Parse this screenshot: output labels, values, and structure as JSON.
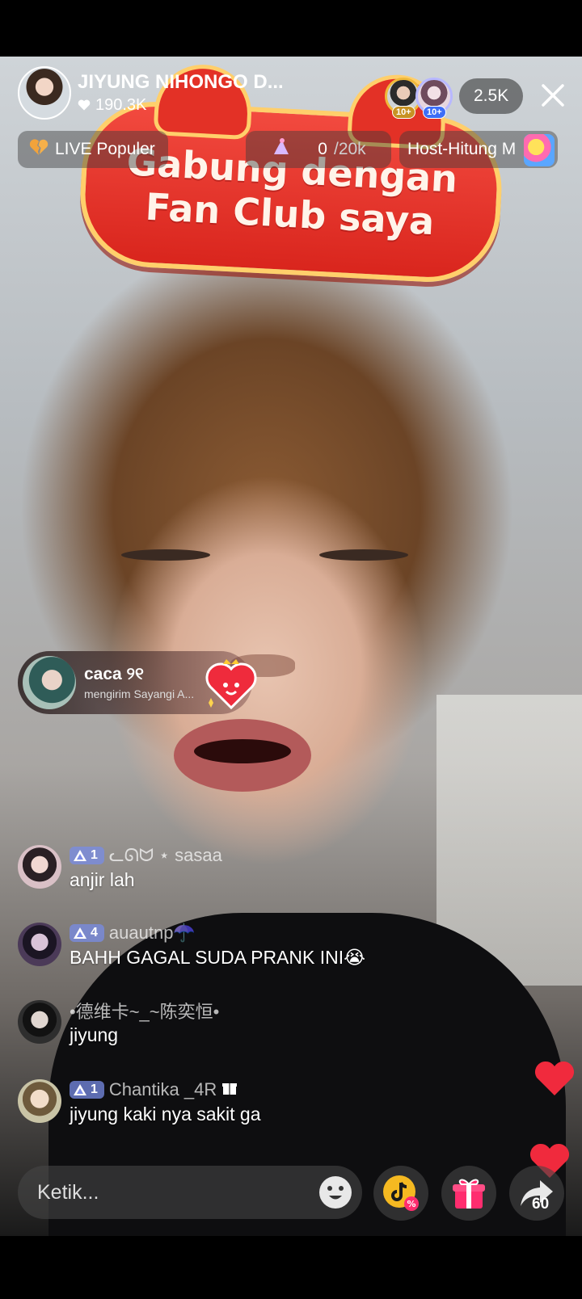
{
  "host": {
    "name": "JIYUNG NIHONGO D...",
    "likes": "190.3K"
  },
  "viewers": {
    "badge_1": "10+",
    "badge_2": "10+",
    "count": "2.5K"
  },
  "chips": {
    "live_populer": "LIVE Populer",
    "goal_current": "0",
    "goal_total": "/20k",
    "rank_label": "Host-Hitung M"
  },
  "fan_club": {
    "line1": "Gabung dengan",
    "line2": "Fan Club saya"
  },
  "gift_notification": {
    "user": "caca ୨୧",
    "text": "mengirim Sayangi A..."
  },
  "comments": [
    {
      "level": "1",
      "username": "ᓚᘏᗢ ⋆ sasaa",
      "text": "anjir lah"
    },
    {
      "level": "4",
      "username": "auautnp☂️",
      "text": "BAHH GAGAL SUDA PRANK INI😭"
    },
    {
      "level": "",
      "username": "•德维卡~_~陈奕恒•",
      "text": "jiyung"
    },
    {
      "level": "1",
      "username": "Chantika _4R",
      "text": "jiyung kaki nya sakit ga"
    }
  ],
  "bottom": {
    "input_placeholder": "Ketik...",
    "share_count": "60"
  },
  "colors": {
    "heart_red": "#f02a3d",
    "level_badge": "#7c8ce6",
    "tiktok_coin": "#f5b921",
    "gift_pink": "#ff2d6f"
  }
}
